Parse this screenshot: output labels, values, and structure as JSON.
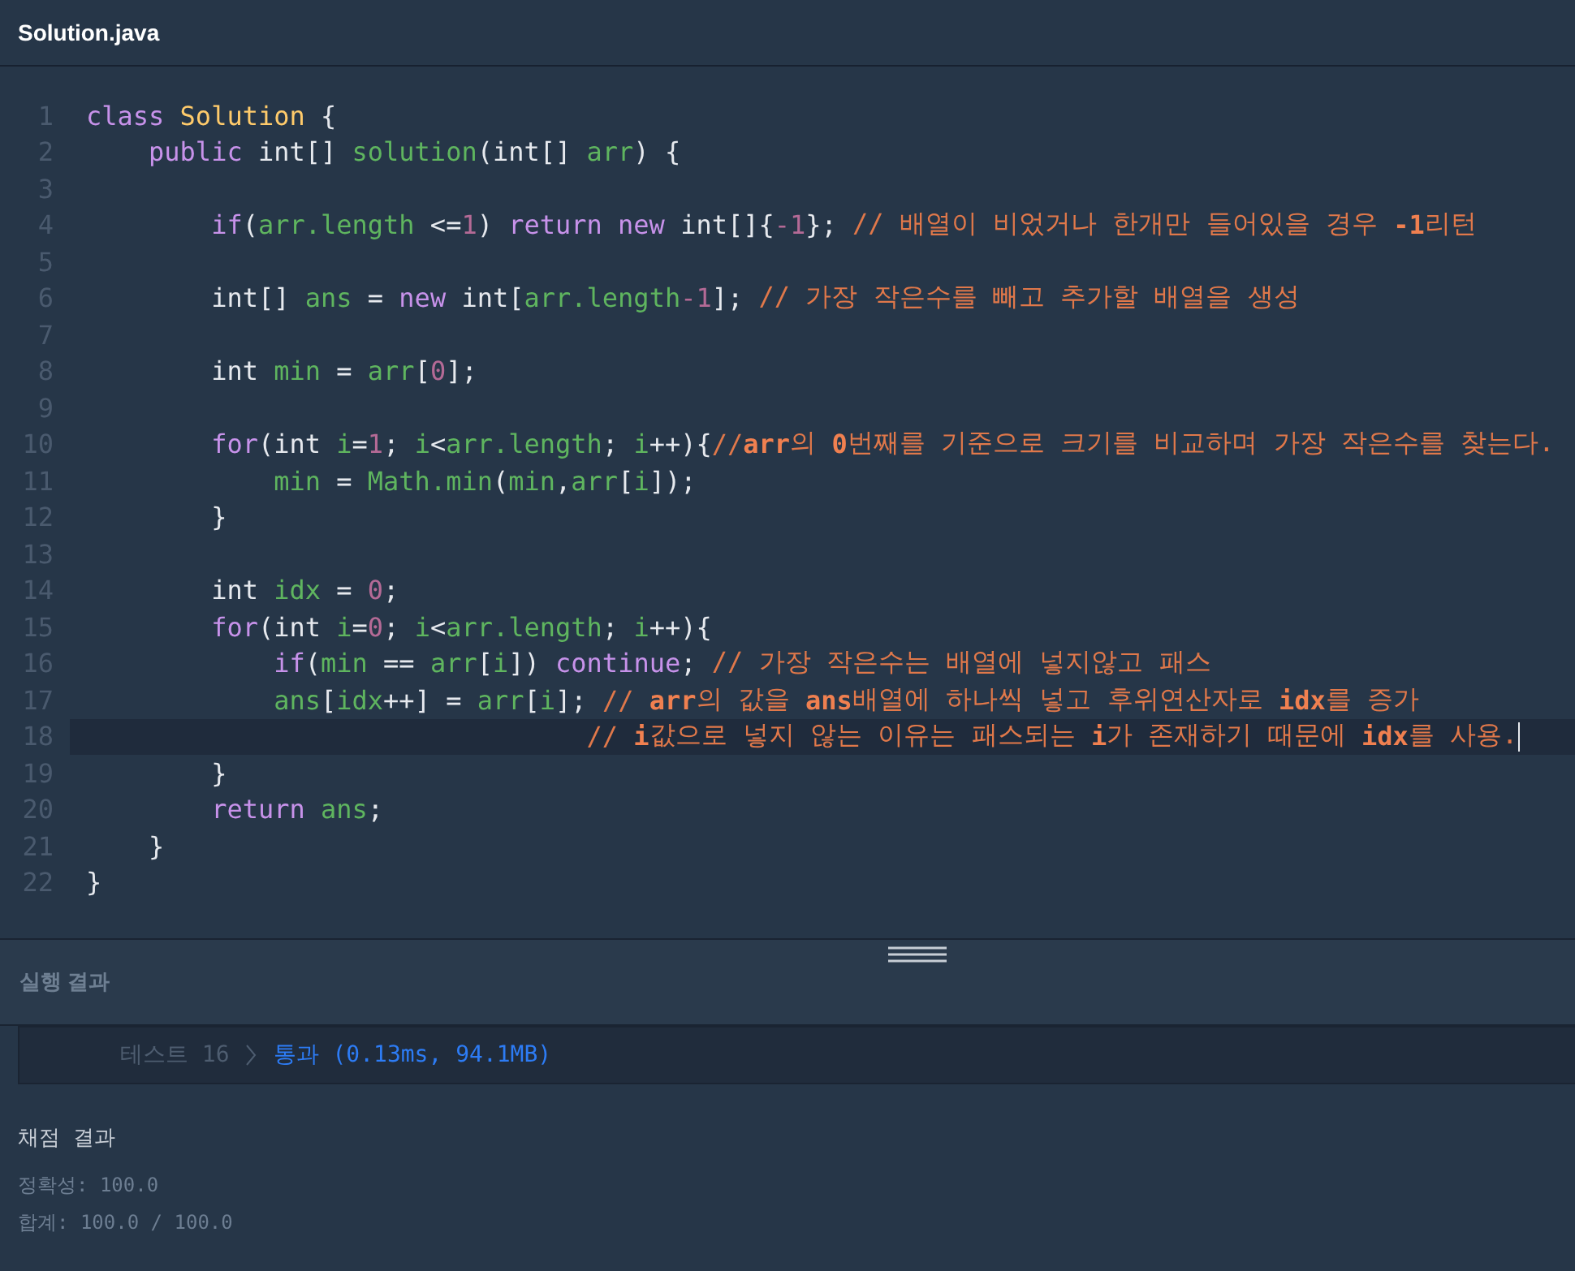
{
  "file_tab": {
    "title": "Solution.java"
  },
  "code_lines": [
    {
      "number": "1",
      "current": false,
      "tokens": [
        {
          "kind": "kw",
          "text": "class "
        },
        {
          "kind": "cls",
          "text": "Solution"
        },
        {
          "kind": "plain",
          "text": " {"
        }
      ]
    },
    {
      "number": "2",
      "current": false,
      "tokens": [
        {
          "kind": "kw",
          "text": "    public"
        },
        {
          "kind": "plain",
          "text": " int[] "
        },
        {
          "kind": "name",
          "text": "solution"
        },
        {
          "kind": "plain",
          "text": "(int[] "
        },
        {
          "kind": "name",
          "text": "arr"
        },
        {
          "kind": "plain",
          "text": ") {"
        }
      ]
    },
    {
      "number": "3",
      "current": false
    },
    {
      "number": "4",
      "current": false,
      "tokens": [
        {
          "kind": "kw",
          "text": "        if"
        },
        {
          "kind": "plain",
          "text": "("
        },
        {
          "kind": "name",
          "text": "arr.length"
        },
        {
          "kind": "plain",
          "text": " <="
        },
        {
          "kind": "num",
          "text": "1"
        },
        {
          "kind": "plain",
          "text": ") "
        },
        {
          "kind": "kw",
          "text": "return new"
        },
        {
          "kind": "plain",
          "text": " int[]{"
        },
        {
          "kind": "num",
          "text": "-1"
        },
        {
          "kind": "plain",
          "text": "}; "
        },
        {
          "kind": "cm",
          "text": "// 배열이 비었거나 한개만 들어있을 경우 "
        },
        {
          "kind": "cmb",
          "text": "-1"
        },
        {
          "kind": "cm",
          "text": "리턴"
        }
      ]
    },
    {
      "number": "5",
      "current": false
    },
    {
      "number": "6",
      "current": false,
      "tokens": [
        {
          "kind": "plain",
          "text": "        int[] "
        },
        {
          "kind": "name",
          "text": "ans"
        },
        {
          "kind": "plain",
          "text": " = "
        },
        {
          "kind": "kw",
          "text": "new"
        },
        {
          "kind": "plain",
          "text": " int["
        },
        {
          "kind": "name",
          "text": "arr.length"
        },
        {
          "kind": "num",
          "text": "-1"
        },
        {
          "kind": "plain",
          "text": "]; "
        },
        {
          "kind": "cm",
          "text": "// 가장 작은수를 빼고 추가할 배열을 생성"
        }
      ]
    },
    {
      "number": "7",
      "current": false
    },
    {
      "number": "8",
      "current": false,
      "tokens": [
        {
          "kind": "plain",
          "text": "        int "
        },
        {
          "kind": "name",
          "text": "min"
        },
        {
          "kind": "plain",
          "text": " = "
        },
        {
          "kind": "name",
          "text": "arr"
        },
        {
          "kind": "plain",
          "text": "["
        },
        {
          "kind": "num",
          "text": "0"
        },
        {
          "kind": "plain",
          "text": "];"
        }
      ]
    },
    {
      "number": "9",
      "current": false
    },
    {
      "number": "10",
      "current": false,
      "tokens": [
        {
          "kind": "kw",
          "text": "        for"
        },
        {
          "kind": "plain",
          "text": "(int "
        },
        {
          "kind": "name",
          "text": "i"
        },
        {
          "kind": "plain",
          "text": "="
        },
        {
          "kind": "num",
          "text": "1"
        },
        {
          "kind": "plain",
          "text": "; "
        },
        {
          "kind": "name",
          "text": "i"
        },
        {
          "kind": "plain",
          "text": "<"
        },
        {
          "kind": "name",
          "text": "arr.length"
        },
        {
          "kind": "plain",
          "text": "; "
        },
        {
          "kind": "name",
          "text": "i"
        },
        {
          "kind": "plain",
          "text": "++){"
        },
        {
          "kind": "cm",
          "text": "//"
        },
        {
          "kind": "cmb",
          "text": "arr"
        },
        {
          "kind": "cm",
          "text": "의 "
        },
        {
          "kind": "cmb",
          "text": "0"
        },
        {
          "kind": "cm",
          "text": "번째를 기준으로 크기를 비교하며 가장 작은수를 찾는다."
        }
      ]
    },
    {
      "number": "11",
      "current": false,
      "tokens": [
        {
          "kind": "name",
          "text": "            min"
        },
        {
          "kind": "plain",
          "text": " = "
        },
        {
          "kind": "name",
          "text": "Math.min"
        },
        {
          "kind": "plain",
          "text": "("
        },
        {
          "kind": "name",
          "text": "min"
        },
        {
          "kind": "plain",
          "text": ","
        },
        {
          "kind": "name",
          "text": "arr"
        },
        {
          "kind": "plain",
          "text": "["
        },
        {
          "kind": "name",
          "text": "i"
        },
        {
          "kind": "plain",
          "text": "]);"
        }
      ]
    },
    {
      "number": "12",
      "current": false,
      "tokens": [
        {
          "kind": "plain",
          "text": "        }"
        }
      ]
    },
    {
      "number": "13",
      "current": false
    },
    {
      "number": "14",
      "current": false,
      "tokens": [
        {
          "kind": "plain",
          "text": "        int "
        },
        {
          "kind": "name",
          "text": "idx"
        },
        {
          "kind": "plain",
          "text": " = "
        },
        {
          "kind": "num",
          "text": "0"
        },
        {
          "kind": "plain",
          "text": ";"
        }
      ]
    },
    {
      "number": "15",
      "current": false,
      "tokens": [
        {
          "kind": "kw",
          "text": "        for"
        },
        {
          "kind": "plain",
          "text": "(int "
        },
        {
          "kind": "name",
          "text": "i"
        },
        {
          "kind": "plain",
          "text": "="
        },
        {
          "kind": "num",
          "text": "0"
        },
        {
          "kind": "plain",
          "text": "; "
        },
        {
          "kind": "name",
          "text": "i"
        },
        {
          "kind": "plain",
          "text": "<"
        },
        {
          "kind": "name",
          "text": "arr.length"
        },
        {
          "kind": "plain",
          "text": "; "
        },
        {
          "kind": "name",
          "text": "i"
        },
        {
          "kind": "plain",
          "text": "++){"
        }
      ]
    },
    {
      "number": "16",
      "current": false,
      "tokens": [
        {
          "kind": "kw",
          "text": "            if"
        },
        {
          "kind": "plain",
          "text": "("
        },
        {
          "kind": "name",
          "text": "min"
        },
        {
          "kind": "plain",
          "text": " == "
        },
        {
          "kind": "name",
          "text": "arr"
        },
        {
          "kind": "plain",
          "text": "["
        },
        {
          "kind": "name",
          "text": "i"
        },
        {
          "kind": "plain",
          "text": "]) "
        },
        {
          "kind": "kw",
          "text": "continue"
        },
        {
          "kind": "plain",
          "text": "; "
        },
        {
          "kind": "cm",
          "text": "// 가장 작은수는 배열에 넣지않고 패스"
        }
      ]
    },
    {
      "number": "17",
      "current": false,
      "tokens": [
        {
          "kind": "name",
          "text": "            ans"
        },
        {
          "kind": "plain",
          "text": "["
        },
        {
          "kind": "name",
          "text": "idx"
        },
        {
          "kind": "plain",
          "text": "++] = "
        },
        {
          "kind": "name",
          "text": "arr"
        },
        {
          "kind": "plain",
          "text": "["
        },
        {
          "kind": "name",
          "text": "i"
        },
        {
          "kind": "plain",
          "text": "]; "
        },
        {
          "kind": "cm",
          "text": "// "
        },
        {
          "kind": "cmb",
          "text": "arr"
        },
        {
          "kind": "cm",
          "text": "의 값을 "
        },
        {
          "kind": "cmb",
          "text": "ans"
        },
        {
          "kind": "cm",
          "text": "배열에 하나씩 넣고 후위연산자로 "
        },
        {
          "kind": "cmb",
          "text": "idx"
        },
        {
          "kind": "cm",
          "text": "를 증가"
        }
      ]
    },
    {
      "number": "18",
      "current": true,
      "tokens": [
        {
          "kind": "cm",
          "text": "                                // "
        },
        {
          "kind": "cmb",
          "text": "i"
        },
        {
          "kind": "cm",
          "text": "값으로 넣지 않는 이유는 패스되는 "
        },
        {
          "kind": "cmb",
          "text": "i"
        },
        {
          "kind": "cm",
          "text": "가 존재하기 때문에 "
        },
        {
          "kind": "cmb",
          "text": "idx"
        },
        {
          "kind": "cm",
          "text": "를 사용."
        }
      ]
    },
    {
      "number": "19",
      "current": false,
      "tokens": [
        {
          "kind": "plain",
          "text": "        }"
        }
      ]
    },
    {
      "number": "20",
      "current": false,
      "tokens": [
        {
          "kind": "kw",
          "text": "        return"
        },
        {
          "kind": "name",
          "text": " ans"
        },
        {
          "kind": "plain",
          "text": ";"
        }
      ]
    },
    {
      "number": "21",
      "current": false,
      "tokens": [
        {
          "kind": "plain",
          "text": "    }"
        }
      ]
    },
    {
      "number": "22",
      "current": false,
      "tokens": [
        {
          "kind": "plain",
          "text": "}"
        }
      ]
    }
  ],
  "run_panel": {
    "title": "실행 결과",
    "tests": [
      {
        "label": "테스트 16",
        "result": "통과 (0.13ms, 94.1MB)"
      }
    ]
  },
  "grading": {
    "title": "채점 결과",
    "accuracy": "정확성: 100.0",
    "total": "합계: 100.0 / 100.0"
  }
}
